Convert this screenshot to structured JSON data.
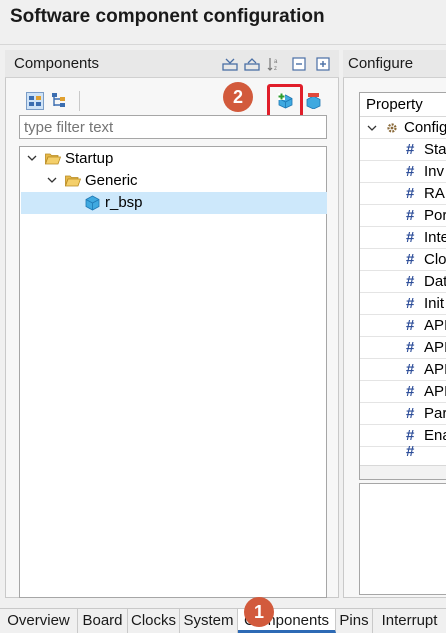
{
  "window": {
    "title": "Software component configuration"
  },
  "components_panel": {
    "title": "Components",
    "filter": {
      "placeholder": "type filter text",
      "value": ""
    },
    "tree": [
      {
        "label": "Startup",
        "level": 0,
        "expanded": true,
        "type": "folder"
      },
      {
        "label": "Generic",
        "level": 1,
        "expanded": true,
        "type": "folder"
      },
      {
        "label": "r_bsp",
        "level": 2,
        "type": "component",
        "selected": true
      }
    ]
  },
  "configure_panel": {
    "title": "Configure",
    "column_header": "Property",
    "root_label": "Config",
    "rows": [
      "Sta",
      "Inv",
      "RAI",
      "Por",
      "Inte",
      "Clo",
      "Dat",
      "Init",
      "API",
      "API",
      "API",
      "API",
      "Par",
      "Ena"
    ]
  },
  "bottom_tabs": {
    "items": [
      {
        "label": "Overview"
      },
      {
        "label": "Board"
      },
      {
        "label": "Clocks"
      },
      {
        "label": "System"
      },
      {
        "label": "Components",
        "active": true
      },
      {
        "label": "Pins"
      },
      {
        "label": "Interrupt"
      }
    ]
  },
  "callouts": {
    "first": "1",
    "second": "2"
  },
  "colors": {
    "badge": "#d25a3c",
    "highlight_box": "#e01e2a",
    "selection": "#cde8fb",
    "active_tab_underline": "#2d6ab5"
  },
  "icons": {
    "header_toolbar": [
      "collapse-all-icon",
      "expand-all-icon",
      "sort-alpha-icon",
      "minimize-icon",
      "maximize-icon"
    ],
    "view_toggles": [
      "view-by-category-icon",
      "view-by-hierarchy-icon"
    ],
    "actions": [
      "add-component-icon",
      "remove-component-icon"
    ]
  }
}
